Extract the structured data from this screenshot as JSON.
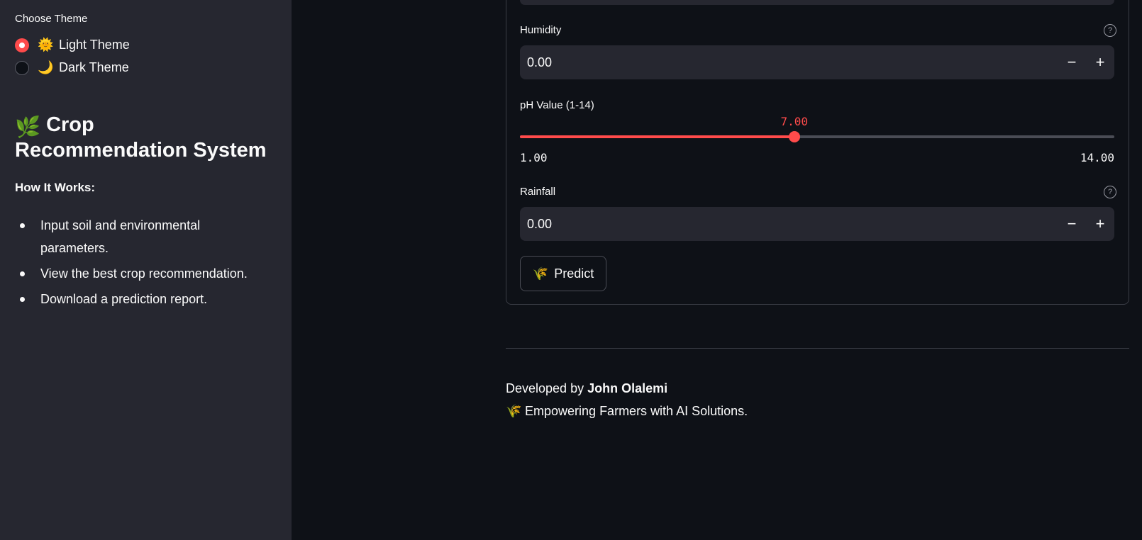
{
  "sidebar": {
    "theme_label": "Choose Theme",
    "theme_options": [
      {
        "emoji": "🌞",
        "label": "Light Theme",
        "selected": true
      },
      {
        "emoji": "🌙",
        "label": "Dark Theme",
        "selected": false
      }
    ],
    "title_emoji": "🌿",
    "title": "Crop Recommendation System",
    "how_heading": "How It Works:",
    "steps": [
      "Input soil and environmental parameters.",
      "View the best crop recommendation.",
      "Download a prediction report."
    ]
  },
  "form": {
    "humidity": {
      "label": "Humidity",
      "value": "0.00",
      "minus": "−",
      "plus": "+",
      "help": "?"
    },
    "ph": {
      "label": "pH Value (1-14)",
      "value": "7.00",
      "min": "1.00",
      "max": "14.00",
      "current": 7,
      "range": [
        1,
        14
      ]
    },
    "rainfall": {
      "label": "Rainfall",
      "value": "0.00",
      "minus": "−",
      "plus": "+",
      "help": "?"
    },
    "predict": {
      "emoji": "🌾",
      "label": "Predict"
    }
  },
  "footer": {
    "developed_prefix": "Developed by",
    "developer": "John Olalemi",
    "tagline_emoji": "🌾",
    "tagline": "Empowering Farmers with AI Solutions."
  },
  "colors": {
    "accent": "#ff4b4b",
    "background": "#0e1117",
    "sidebar": "#262730",
    "input": "#262730",
    "text": "#fafafa"
  }
}
